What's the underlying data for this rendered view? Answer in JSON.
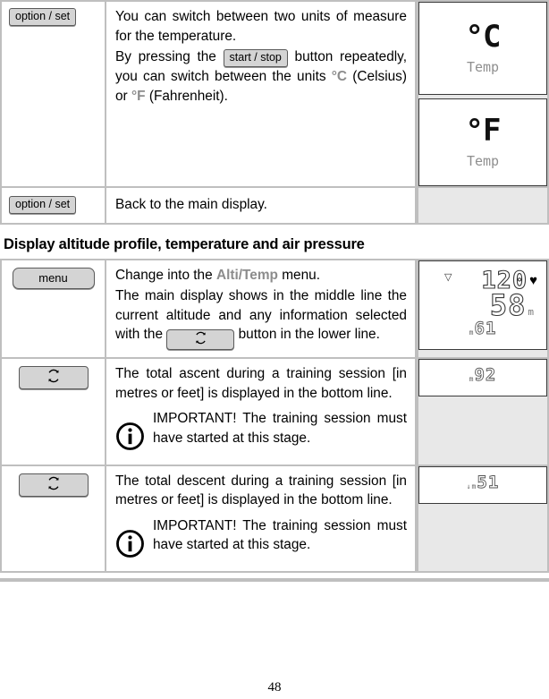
{
  "page": {
    "number": "48"
  },
  "table_top": {
    "rows": [
      {
        "button": "option / set",
        "paragraphs": [
          "You can switch between two units of measure for the temperature.",
          "By pressing the |start / stop| button repeatedly, you can switch between the units °C (Celsius) or °F (Fahrenheit)."
        ],
        "inline_button": "start / stop",
        "text_before_button": "By pressing the",
        "text_after_button": "button repeatedly, you can switch between the units",
        "celsius_symbol": "°C",
        "celsius_word": "(Celsius) or",
        "fahrenheit_symbol": "°F",
        "fahrenheit_word": "(Fahrenheit).",
        "displays": [
          {
            "value": "°C",
            "label": "Temp"
          },
          {
            "value": "°F",
            "label": "Temp"
          }
        ]
      },
      {
        "button": "option / set",
        "text": "Back to the main display."
      }
    ]
  },
  "heading": "Display altitude profile, temperature and air pressure",
  "table_bottom": {
    "rows": [
      {
        "button_label": "menu",
        "button_type": "label",
        "line1_before": "Change into the",
        "line1_menu": "Alti/Temp",
        "line1_after": "menu.",
        "line2": "The main display shows in the middle line the current altitude and any information selected with the",
        "line3_after": "button in the lower line.",
        "display": {
          "type": "profile",
          "top_value": "120",
          "heart": "♥",
          "triangle": "▽",
          "mid_value": "58",
          "mid_unit": "m",
          "bottom_value": "61",
          "bottom_sub": "m"
        }
      },
      {
        "button_label": "",
        "button_type": "cycle",
        "text": "The total ascent during a training session [in metres or feet] is displayed in the bottom line.",
        "note_title": "IMPORTANT!",
        "note_text": "IMPORTANT! The training session must have started at this stage.",
        "display": {
          "type": "small",
          "value": "92",
          "unit": "m"
        }
      },
      {
        "button_label": "",
        "button_type": "cycle",
        "text": "The total descent during a training session [in metres or feet] is displayed in the bottom line.",
        "note_title": "IMPORTANT!",
        "note_text": "IMPORTANT! The training session must have started at this stage.",
        "display": {
          "type": "small",
          "value": "51",
          "unit": "m",
          "arrow": "↓"
        }
      }
    ]
  },
  "icons": {
    "cycle": "cycle-arrows-icon",
    "info": "info-circle-icon"
  }
}
